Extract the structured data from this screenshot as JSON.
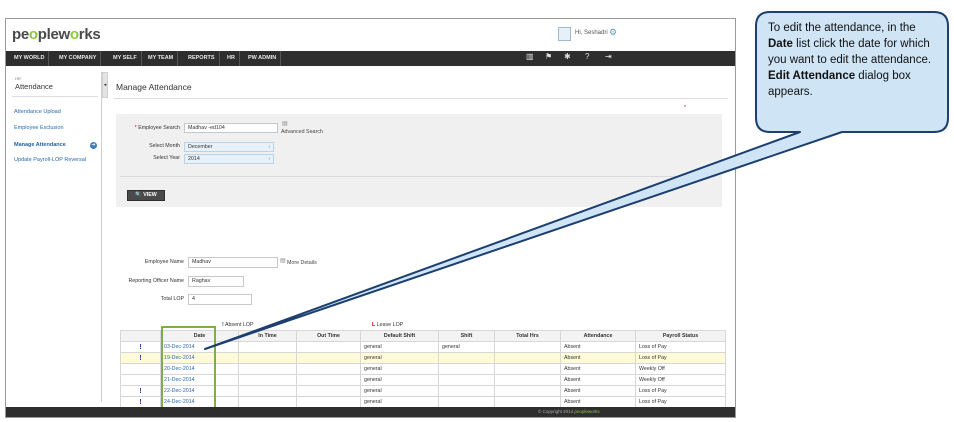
{
  "app": {
    "logo_pre": "pe",
    "logo_o": "o",
    "logo_post": "plew",
    "logo_o2": "o",
    "logo_end": "rks",
    "greeting": "Hi, Seshadri"
  },
  "nav": {
    "items": [
      "MY WORLD",
      "MY COMPANY",
      "MY SELF",
      "MY TEAM",
      "REPORTS",
      "HR",
      "PW ADMIN"
    ]
  },
  "sidebar": {
    "small_label": "HR",
    "title": "Attendance",
    "items": [
      "Attendance Upload",
      "Employee Exclusion",
      "Manage Attendance",
      "Update Payroll-LOP Reversal"
    ]
  },
  "main": {
    "page_title": "Manage Attendance",
    "required_mark": "*",
    "search": {
      "employee_label": "Employee Search",
      "employee_value": "Madhav -ed104",
      "advanced_search": "Advanced Search",
      "month_label": "Select Month",
      "month_value": "December",
      "year_label": "Select Year",
      "year_value": "2014",
      "view_button": "VIEW"
    },
    "info": {
      "employee_name_label": "Employee Name",
      "employee_name_value": "Madhav",
      "more_details": "More Details",
      "reporting_label": "Reporting Officer Name",
      "reporting_value": "Raghav",
      "total_lop_label": "Total LOP",
      "total_lop_value": "4"
    },
    "legend": {
      "absent_mark": "!",
      "absent_label": "Absent LOP",
      "leave_mark": "L",
      "leave_label": "Leave LOP"
    },
    "table": {
      "columns": [
        "",
        "Date",
        "In Time",
        "Out Time",
        "Default Shift",
        "Shift",
        "Total Hrs",
        "Attendance",
        "Payroll Status"
      ],
      "rows": [
        {
          "flag": "!",
          "date": "03-Dec-2014",
          "in": "",
          "out": "",
          "default_shift": "general",
          "shift": "general",
          "hrs": "",
          "attendance": "Absent",
          "payroll": "Loss of Pay"
        },
        {
          "flag": "!",
          "date": "19-Dec-2014",
          "in": "",
          "out": "",
          "default_shift": "general",
          "shift": "",
          "hrs": "",
          "attendance": "Absent",
          "payroll": "Loss of Pay"
        },
        {
          "flag": "",
          "date": "20-Dec-2014",
          "in": "",
          "out": "",
          "default_shift": "general",
          "shift": "",
          "hrs": "",
          "attendance": "Absent",
          "payroll": "Weekly Off"
        },
        {
          "flag": "",
          "date": "21-Dec-2014",
          "in": "",
          "out": "",
          "default_shift": "general",
          "shift": "",
          "hrs": "",
          "attendance": "Absent",
          "payroll": "Weekly Off"
        },
        {
          "flag": "!",
          "date": "22-Dec-2014",
          "in": "",
          "out": "",
          "default_shift": "general",
          "shift": "",
          "hrs": "",
          "attendance": "Absent",
          "payroll": "Loss of Pay"
        },
        {
          "flag": "!",
          "date": "24-Dec-2014",
          "in": "",
          "out": "",
          "default_shift": "general",
          "shift": "",
          "hrs": "",
          "attendance": "Absent",
          "payroll": "Loss of Pay"
        }
      ]
    }
  },
  "footer": {
    "copyright": "© Copyright 2014",
    "logo": "peoplew",
    "logo_o": "o",
    "logo_end": "rks"
  },
  "callout": {
    "t1": "To edit the attendance, in the ",
    "b1": "Date",
    "t2": " list click the date for which you want to edit the attendance. ",
    "b2": "Edit Attendance",
    "t3": " dialog box appears."
  },
  "colors": {
    "accent_green": "#8cc63f",
    "nav_dark": "#2e2e2e",
    "link_blue": "#2a6aaa",
    "callout_fill": "#cfe4f5",
    "callout_border": "#1c3f70",
    "highlight_box": "#7ab04a"
  }
}
